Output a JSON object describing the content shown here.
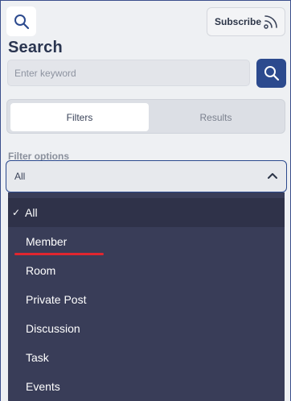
{
  "header": {
    "search_icon": "search-icon",
    "subscribe_label": "Subscribe",
    "subscribe_icon": "rss-icon"
  },
  "search": {
    "title": "Search",
    "placeholder": "Enter keyword",
    "value": "",
    "submit_icon": "search-icon"
  },
  "tabs": [
    {
      "label": "Filters",
      "active": true
    },
    {
      "label": "Results",
      "active": false
    }
  ],
  "filter": {
    "label": "Filter options",
    "selected": "All",
    "options": [
      {
        "label": "All",
        "checked": true
      },
      {
        "label": "Member",
        "checked": false
      },
      {
        "label": "Room",
        "checked": false
      },
      {
        "label": "Private Post",
        "checked": false
      },
      {
        "label": "Discussion",
        "checked": false
      },
      {
        "label": "Task",
        "checked": false
      },
      {
        "label": "Events",
        "checked": false
      }
    ],
    "check_glyph": "✓"
  },
  "colors": {
    "accent": "#2c4a8e",
    "dropdown_bg": "#393d58",
    "annotation_red": "#e0262f"
  }
}
